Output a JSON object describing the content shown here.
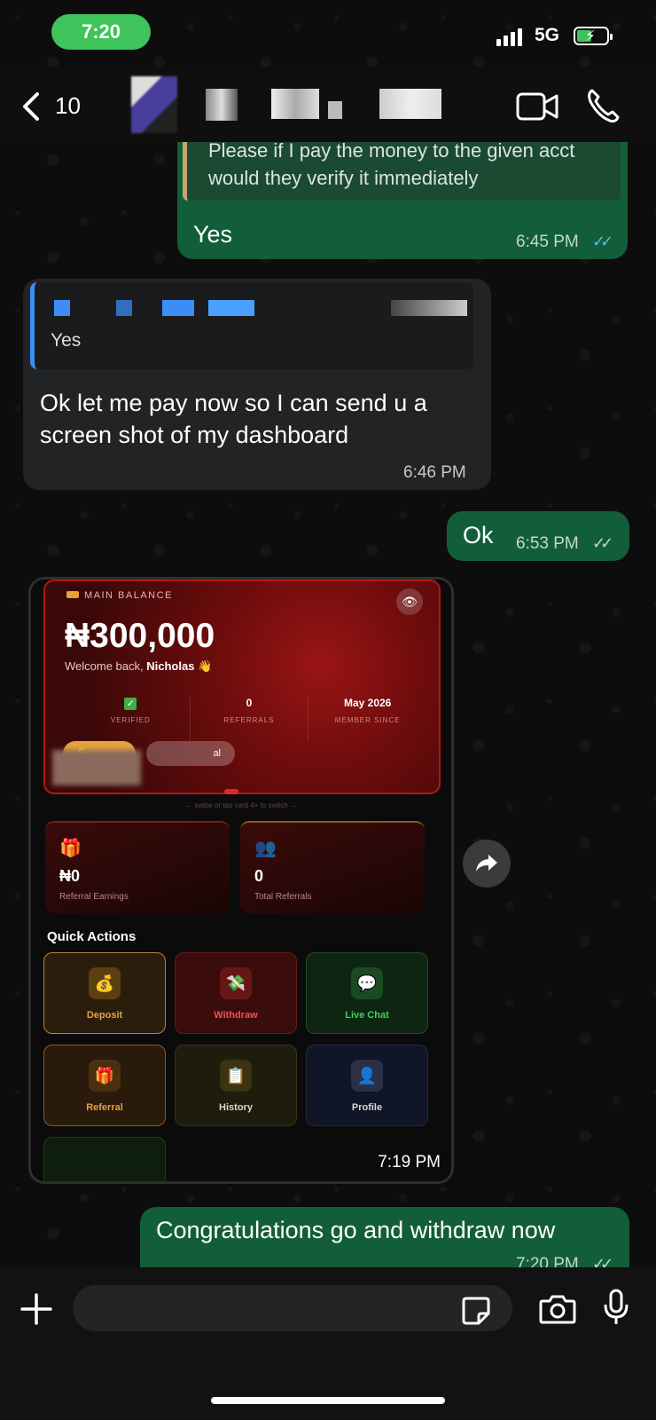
{
  "status_bar": {
    "time": "7:20",
    "network": "5G"
  },
  "header": {
    "back_count": "10"
  },
  "messages": [
    {
      "quote": "Please if I pay the money to the given acct would they verify it immediately",
      "text": "Yes",
      "time": "6:45 PM",
      "status": "read"
    },
    {
      "quote_text": "Yes",
      "text": "Ok let me pay now so I can send u a screen shot of my dashboard",
      "time": "6:46 PM"
    },
    {
      "text": "Ok",
      "time": "6:53 PM",
      "status": "sent"
    },
    {
      "time": "7:19 PM"
    },
    {
      "text": "Congratulations go and withdraw now",
      "time": "7:20 PM",
      "status": "sent"
    }
  ],
  "dashboard": {
    "label": "MAIN BALANCE",
    "balance": "₦300,000",
    "welcome": "Welcome back,",
    "user": "Nicholas",
    "stats": [
      {
        "value": "",
        "label": "VERIFIED"
      },
      {
        "value": "0",
        "label": "REFERRALS"
      },
      {
        "value": "May 2026",
        "label": "MEMBER SINCE"
      }
    ],
    "pill2": "al",
    "swipe": "← swipe or tap card 4+ to switch →",
    "cards": [
      {
        "value": "₦0",
        "label": "Referral Earnings"
      },
      {
        "value": "0",
        "label": "Total Referrals"
      }
    ],
    "quick_actions_title": "Quick Actions",
    "actions": [
      {
        "label": "Deposit",
        "icon": "money-bag-icon",
        "color": "#e6a23c"
      },
      {
        "label": "Withdraw",
        "icon": "cash-icon",
        "color": "#ff4d4d"
      },
      {
        "label": "Live Chat",
        "icon": "chat-icon",
        "color": "#39d353"
      },
      {
        "label": "Referral",
        "icon": "gift-icon",
        "color": "#e6a23c"
      },
      {
        "label": "History",
        "icon": "clipboard-icon",
        "color": "#d8d8d8"
      },
      {
        "label": "Profile",
        "icon": "person-icon",
        "color": "#d8d8d8"
      }
    ]
  },
  "colors": {
    "outgoing": "#135e3a",
    "incoming": "#222325",
    "read_tick": "#53bdeb",
    "accent": "#3ec45a"
  }
}
